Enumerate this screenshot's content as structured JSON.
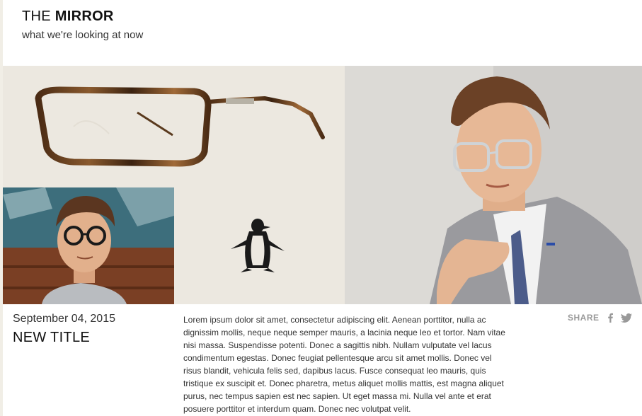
{
  "header": {
    "title_prefix": "THE",
    "title_bold": "MIRROR",
    "subtitle": "what we're looking at now"
  },
  "article": {
    "date": "September 04, 2015",
    "title": "NEW TITLE",
    "body": "Lorem ipsum dolor sit amet, consectetur adipiscing elit. Aenean porttitor, nulla ac dignissim mollis, neque neque semper mauris, a lacinia neque leo et tortor. Nam vitae nisi massa. Suspendisse potenti. Donec a sagittis nibh. Nullam vulputate vel lacus condimentum egestas. Donec feugiat pellentesque arcu sit amet mollis. Donec vel risus blandit, vehicula felis sed, dapibus lacus. Fusce consequat leo mauris, quis tristique ex suscipit et. Donec pharetra, metus aliquet mollis mattis, est magna aliquet purus, nec tempus sapien est nec sapien. Ut eget massa mi. Nulla vel ante et erat posuere porttitor et interdum quam. Donec nec volutpat velit."
  },
  "share": {
    "label": "SHARE",
    "icons": [
      "facebook-icon",
      "twitter-icon"
    ]
  },
  "colors": {
    "panel_bg": "#ece8e0",
    "frame_tortoise": "#6b4423",
    "share_gray": "#999999"
  }
}
